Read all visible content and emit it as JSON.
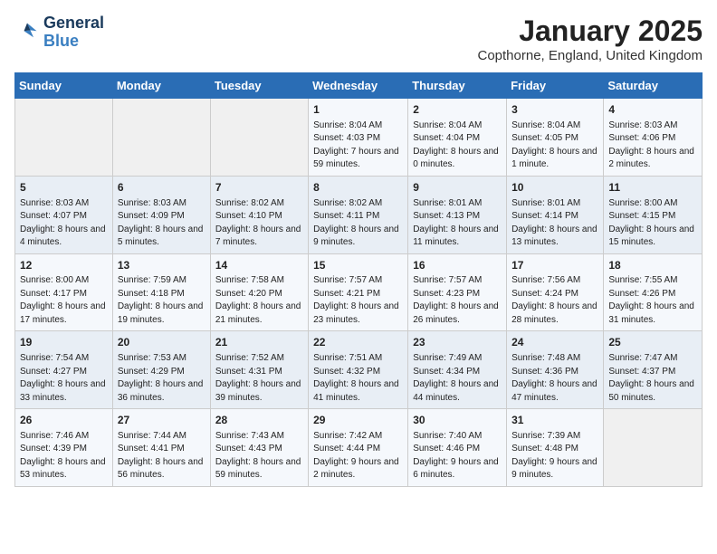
{
  "header": {
    "logo_line1": "General",
    "logo_line2": "Blue",
    "title": "January 2025",
    "subtitle": "Copthorne, England, United Kingdom"
  },
  "columns": [
    "Sunday",
    "Monday",
    "Tuesday",
    "Wednesday",
    "Thursday",
    "Friday",
    "Saturday"
  ],
  "weeks": [
    [
      {
        "day": "",
        "info": ""
      },
      {
        "day": "",
        "info": ""
      },
      {
        "day": "",
        "info": ""
      },
      {
        "day": "1",
        "info": "Sunrise: 8:04 AM\nSunset: 4:03 PM\nDaylight: 7 hours and 59 minutes."
      },
      {
        "day": "2",
        "info": "Sunrise: 8:04 AM\nSunset: 4:04 PM\nDaylight: 8 hours and 0 minutes."
      },
      {
        "day": "3",
        "info": "Sunrise: 8:04 AM\nSunset: 4:05 PM\nDaylight: 8 hours and 1 minute."
      },
      {
        "day": "4",
        "info": "Sunrise: 8:03 AM\nSunset: 4:06 PM\nDaylight: 8 hours and 2 minutes."
      }
    ],
    [
      {
        "day": "5",
        "info": "Sunrise: 8:03 AM\nSunset: 4:07 PM\nDaylight: 8 hours and 4 minutes."
      },
      {
        "day": "6",
        "info": "Sunrise: 8:03 AM\nSunset: 4:09 PM\nDaylight: 8 hours and 5 minutes."
      },
      {
        "day": "7",
        "info": "Sunrise: 8:02 AM\nSunset: 4:10 PM\nDaylight: 8 hours and 7 minutes."
      },
      {
        "day": "8",
        "info": "Sunrise: 8:02 AM\nSunset: 4:11 PM\nDaylight: 8 hours and 9 minutes."
      },
      {
        "day": "9",
        "info": "Sunrise: 8:01 AM\nSunset: 4:13 PM\nDaylight: 8 hours and 11 minutes."
      },
      {
        "day": "10",
        "info": "Sunrise: 8:01 AM\nSunset: 4:14 PM\nDaylight: 8 hours and 13 minutes."
      },
      {
        "day": "11",
        "info": "Sunrise: 8:00 AM\nSunset: 4:15 PM\nDaylight: 8 hours and 15 minutes."
      }
    ],
    [
      {
        "day": "12",
        "info": "Sunrise: 8:00 AM\nSunset: 4:17 PM\nDaylight: 8 hours and 17 minutes."
      },
      {
        "day": "13",
        "info": "Sunrise: 7:59 AM\nSunset: 4:18 PM\nDaylight: 8 hours and 19 minutes."
      },
      {
        "day": "14",
        "info": "Sunrise: 7:58 AM\nSunset: 4:20 PM\nDaylight: 8 hours and 21 minutes."
      },
      {
        "day": "15",
        "info": "Sunrise: 7:57 AM\nSunset: 4:21 PM\nDaylight: 8 hours and 23 minutes."
      },
      {
        "day": "16",
        "info": "Sunrise: 7:57 AM\nSunset: 4:23 PM\nDaylight: 8 hours and 26 minutes."
      },
      {
        "day": "17",
        "info": "Sunrise: 7:56 AM\nSunset: 4:24 PM\nDaylight: 8 hours and 28 minutes."
      },
      {
        "day": "18",
        "info": "Sunrise: 7:55 AM\nSunset: 4:26 PM\nDaylight: 8 hours and 31 minutes."
      }
    ],
    [
      {
        "day": "19",
        "info": "Sunrise: 7:54 AM\nSunset: 4:27 PM\nDaylight: 8 hours and 33 minutes."
      },
      {
        "day": "20",
        "info": "Sunrise: 7:53 AM\nSunset: 4:29 PM\nDaylight: 8 hours and 36 minutes."
      },
      {
        "day": "21",
        "info": "Sunrise: 7:52 AM\nSunset: 4:31 PM\nDaylight: 8 hours and 39 minutes."
      },
      {
        "day": "22",
        "info": "Sunrise: 7:51 AM\nSunset: 4:32 PM\nDaylight: 8 hours and 41 minutes."
      },
      {
        "day": "23",
        "info": "Sunrise: 7:49 AM\nSunset: 4:34 PM\nDaylight: 8 hours and 44 minutes."
      },
      {
        "day": "24",
        "info": "Sunrise: 7:48 AM\nSunset: 4:36 PM\nDaylight: 8 hours and 47 minutes."
      },
      {
        "day": "25",
        "info": "Sunrise: 7:47 AM\nSunset: 4:37 PM\nDaylight: 8 hours and 50 minutes."
      }
    ],
    [
      {
        "day": "26",
        "info": "Sunrise: 7:46 AM\nSunset: 4:39 PM\nDaylight: 8 hours and 53 minutes."
      },
      {
        "day": "27",
        "info": "Sunrise: 7:44 AM\nSunset: 4:41 PM\nDaylight: 8 hours and 56 minutes."
      },
      {
        "day": "28",
        "info": "Sunrise: 7:43 AM\nSunset: 4:43 PM\nDaylight: 8 hours and 59 minutes."
      },
      {
        "day": "29",
        "info": "Sunrise: 7:42 AM\nSunset: 4:44 PM\nDaylight: 9 hours and 2 minutes."
      },
      {
        "day": "30",
        "info": "Sunrise: 7:40 AM\nSunset: 4:46 PM\nDaylight: 9 hours and 6 minutes."
      },
      {
        "day": "31",
        "info": "Sunrise: 7:39 AM\nSunset: 4:48 PM\nDaylight: 9 hours and 9 minutes."
      },
      {
        "day": "",
        "info": ""
      }
    ]
  ]
}
